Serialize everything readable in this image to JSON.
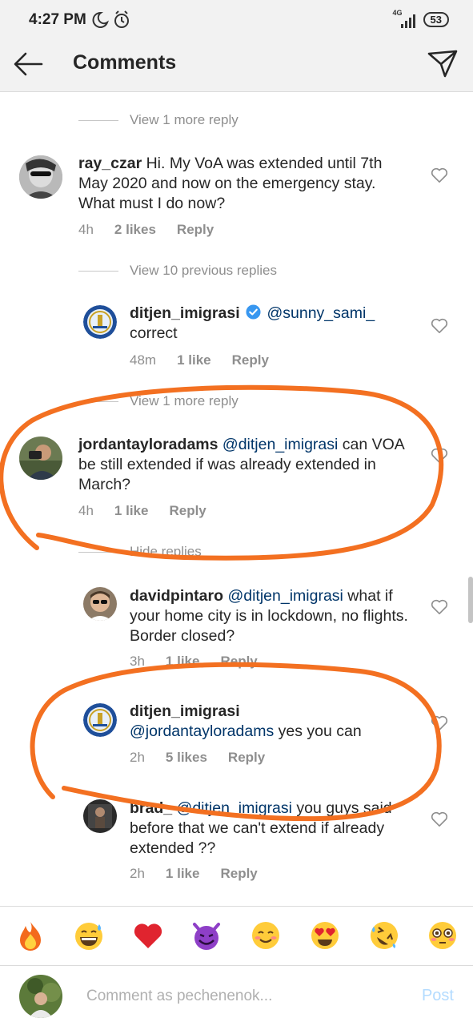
{
  "status_bar": {
    "time": "4:27 PM",
    "network": "4G",
    "battery": "53"
  },
  "header": {
    "title": "Comments"
  },
  "comments": [
    {
      "type": "view_more",
      "label": "View 1 more reply"
    },
    {
      "username": "ray_czar",
      "text": "Hi. My VoA was extended until 7th May 2020 and now on the emergency stay. What must I do now?",
      "time": "4h",
      "likes": "2 likes",
      "reply": "Reply"
    },
    {
      "type": "view_more",
      "label": "View 10 previous replies"
    },
    {
      "username": "ditjen_imigrasi",
      "verified": true,
      "mention": "@sunny_sami_",
      "text": "correct",
      "time": "48m",
      "likes": "1 like",
      "reply": "Reply"
    },
    {
      "type": "view_more",
      "label": "View 1 more reply"
    },
    {
      "username": "jordantayloradams",
      "mention": "@ditjen_imigrasi",
      "text": "can VOA be still extended if was already extended in March?",
      "time": "4h",
      "likes": "1 like",
      "reply": "Reply"
    },
    {
      "type": "view_more",
      "label": "Hide replies"
    },
    {
      "username": "davidpintaro",
      "mention": "@ditjen_imigrasi",
      "text": "what if your home city is in lockdown, no flights. Border closed?",
      "time": "3h",
      "likes": "1 like",
      "reply": "Reply"
    },
    {
      "username": "ditjen_imigrasi",
      "mention": "@jordantayloradams",
      "text": "yes you can",
      "time": "2h",
      "likes": "5 likes",
      "reply": "Reply"
    },
    {
      "username": "brad_",
      "mention": "@ditjen_imigrasi",
      "text": "you guys said before that we can't extend if already extended ??",
      "time": "2h",
      "likes": "1 like",
      "reply": "Reply"
    }
  ],
  "emoji_bar": [
    "🔥",
    "😅",
    "❤️",
    "😈",
    "😊",
    "😍",
    "🤣",
    "😳"
  ],
  "compose": {
    "placeholder": "Comment as pechenenok...",
    "post_label": "Post"
  },
  "colors": {
    "accent": "#3897f0",
    "annotation": "#f37021",
    "mention": "#003569",
    "muted": "#8e8e8e"
  }
}
